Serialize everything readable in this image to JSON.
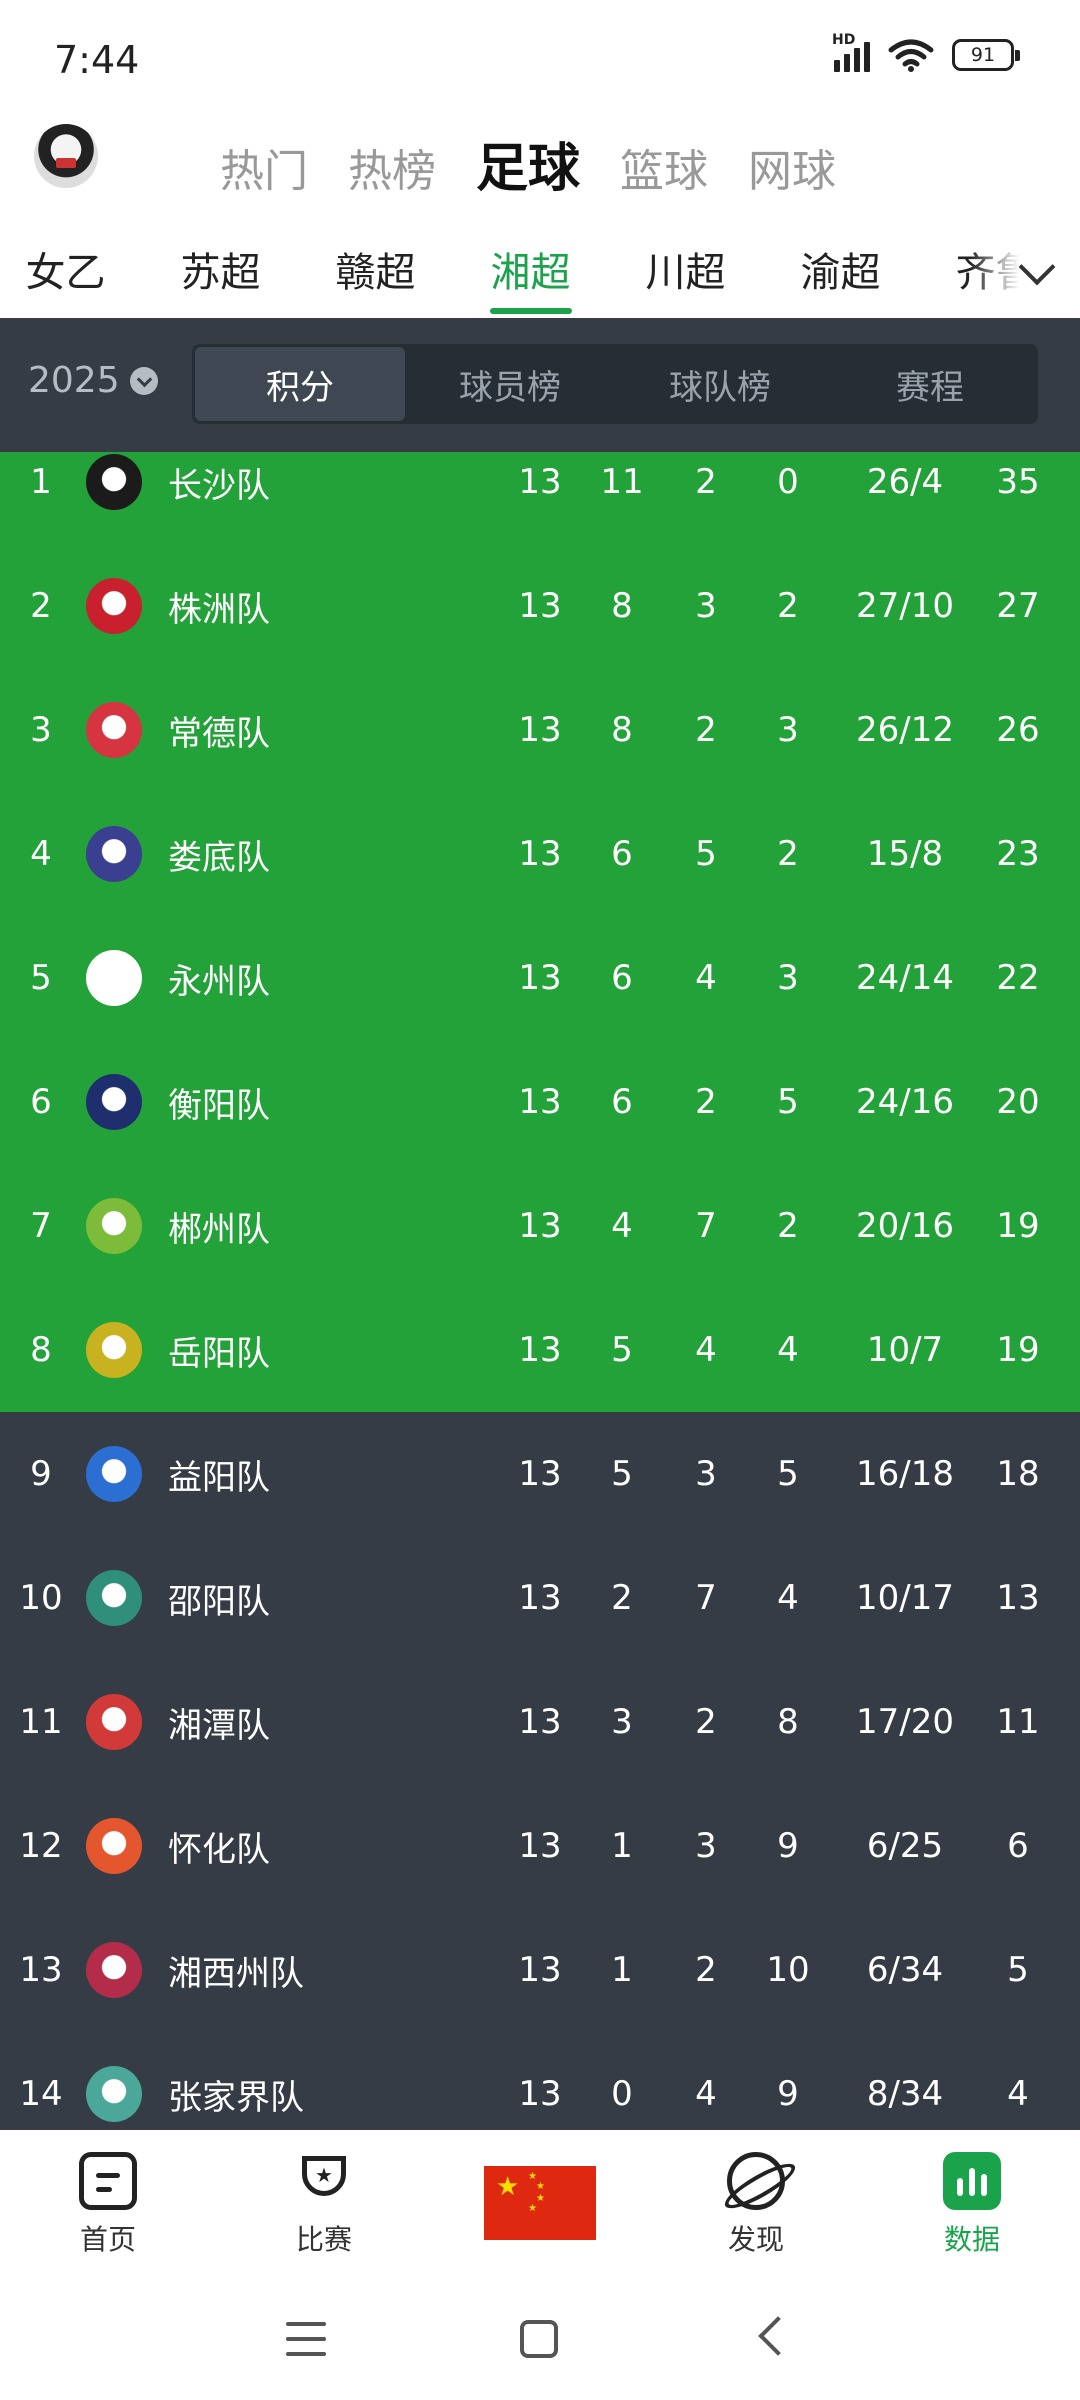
{
  "status": {
    "time": "7:44",
    "network": "HD",
    "battery": "91"
  },
  "sport_tabs": [
    {
      "label": "热门",
      "active": false
    },
    {
      "label": "热榜",
      "active": false
    },
    {
      "label": "足球",
      "active": true
    },
    {
      "label": "篮球",
      "active": false
    },
    {
      "label": "网球",
      "active": false
    }
  ],
  "league_tabs": [
    {
      "label": "女乙",
      "active": false
    },
    {
      "label": "苏超",
      "active": false
    },
    {
      "label": "赣超",
      "active": false
    },
    {
      "label": "湘超",
      "active": true
    },
    {
      "label": "川超",
      "active": false
    },
    {
      "label": "渝超",
      "active": false
    },
    {
      "label": "齐鲁",
      "active": false
    }
  ],
  "filter": {
    "season": "2025",
    "segments": [
      {
        "label": "积分",
        "active": true
      },
      {
        "label": "球员榜",
        "active": false
      },
      {
        "label": "球队榜",
        "active": false
      },
      {
        "label": "赛程",
        "active": false
      }
    ]
  },
  "standings": [
    {
      "rank": "1",
      "team": "长沙队",
      "played": "13",
      "won": "11",
      "drawn": "2",
      "lost": "0",
      "goals": "26/4",
      "points": "35",
      "zone": "promo",
      "logo_color": "#1b1b1b"
    },
    {
      "rank": "2",
      "team": "株洲队",
      "played": "13",
      "won": "8",
      "drawn": "3",
      "lost": "2",
      "goals": "27/10",
      "points": "27",
      "zone": "promo",
      "logo_color": "#c8202c"
    },
    {
      "rank": "3",
      "team": "常德队",
      "played": "13",
      "won": "8",
      "drawn": "2",
      "lost": "3",
      "goals": "26/12",
      "points": "26",
      "zone": "promo",
      "logo_color": "#d63441"
    },
    {
      "rank": "4",
      "team": "娄底队",
      "played": "13",
      "won": "6",
      "drawn": "5",
      "lost": "2",
      "goals": "15/8",
      "points": "23",
      "zone": "promo",
      "logo_color": "#3a3f8f"
    },
    {
      "rank": "5",
      "team": "永州队",
      "played": "13",
      "won": "6",
      "drawn": "4",
      "lost": "3",
      "goals": "24/14",
      "points": "22",
      "zone": "promo",
      "logo_color": "#ffffff"
    },
    {
      "rank": "6",
      "team": "衡阳队",
      "played": "13",
      "won": "6",
      "drawn": "2",
      "lost": "5",
      "goals": "24/16",
      "points": "20",
      "zone": "promo",
      "logo_color": "#1f2f6e"
    },
    {
      "rank": "7",
      "team": "郴州队",
      "played": "13",
      "won": "4",
      "drawn": "7",
      "lost": "2",
      "goals": "20/16",
      "points": "19",
      "zone": "promo",
      "logo_color": "#7dbb3a"
    },
    {
      "rank": "8",
      "team": "岳阳队",
      "played": "13",
      "won": "5",
      "drawn": "4",
      "lost": "4",
      "goals": "10/7",
      "points": "19",
      "zone": "promo",
      "logo_color": "#c9b21f"
    },
    {
      "rank": "9",
      "team": "益阳队",
      "played": "13",
      "won": "5",
      "drawn": "3",
      "lost": "5",
      "goals": "16/18",
      "points": "18",
      "zone": "rel",
      "logo_color": "#2a6fd1"
    },
    {
      "rank": "10",
      "team": "邵阳队",
      "played": "13",
      "won": "2",
      "drawn": "7",
      "lost": "4",
      "goals": "10/17",
      "points": "13",
      "zone": "rel",
      "logo_color": "#2f8f7a"
    },
    {
      "rank": "11",
      "team": "湘潭队",
      "played": "13",
      "won": "3",
      "drawn": "2",
      "lost": "8",
      "goals": "17/20",
      "points": "11",
      "zone": "rel",
      "logo_color": "#d23a3a"
    },
    {
      "rank": "12",
      "team": "怀化队",
      "played": "13",
      "won": "1",
      "drawn": "3",
      "lost": "9",
      "goals": "6/25",
      "points": "6",
      "zone": "rel",
      "logo_color": "#e4572e"
    },
    {
      "rank": "13",
      "team": "湘西州队",
      "played": "13",
      "won": "1",
      "drawn": "2",
      "lost": "10",
      "goals": "6/34",
      "points": "5",
      "zone": "rel",
      "logo_color": "#b32d4a"
    },
    {
      "rank": "14",
      "team": "张家界队",
      "played": "13",
      "won": "0",
      "drawn": "4",
      "lost": "9",
      "goals": "8/34",
      "points": "4",
      "zone": "rel",
      "logo_color": "#4aa79a"
    }
  ],
  "bottom_nav": [
    {
      "label": "首页",
      "icon": "home-icon",
      "active": false
    },
    {
      "label": "比赛",
      "icon": "trophy-icon",
      "active": false
    },
    {
      "label": "",
      "icon": "china-flag-icon",
      "active": false
    },
    {
      "label": "发现",
      "icon": "planet-icon",
      "active": false
    },
    {
      "label": "数据",
      "icon": "data-icon",
      "active": true
    }
  ],
  "colors": {
    "accent": "#1aa34a",
    "promo_row": "#22a238",
    "dark_row": "#353c45"
  }
}
